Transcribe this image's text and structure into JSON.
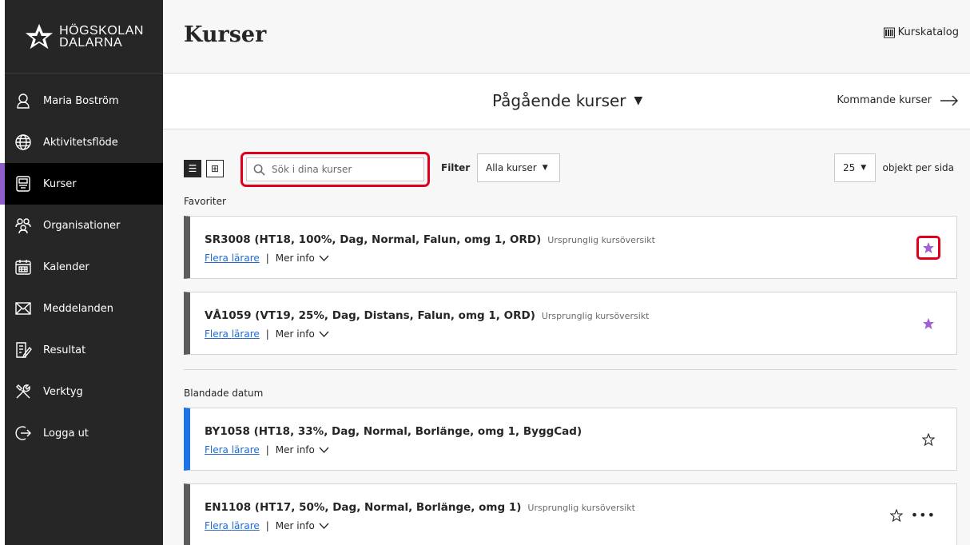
{
  "sidebar": {
    "logo_line1": "HÖGSKOLAN",
    "logo_line2": "DALARNA",
    "items": [
      {
        "label": "Maria Boström",
        "icon": "user-icon"
      },
      {
        "label": "Aktivitetsflöde",
        "icon": "globe-icon"
      },
      {
        "label": "Kurser",
        "icon": "courses-icon"
      },
      {
        "label": "Organisationer",
        "icon": "organizations-icon"
      },
      {
        "label": "Kalender",
        "icon": "calendar-icon"
      },
      {
        "label": "Meddelanden",
        "icon": "envelope-icon"
      },
      {
        "label": "Resultat",
        "icon": "grades-icon"
      },
      {
        "label": "Verktyg",
        "icon": "tools-icon"
      },
      {
        "label": "Logga ut",
        "icon": "logout-icon"
      }
    ],
    "active_item": "Kurser"
  },
  "header": {
    "title": "Kurser",
    "catalog_label": "Kurskatalog"
  },
  "term_bar": {
    "current_term": "Pågående kurser",
    "next_label": "Kommande kurser"
  },
  "toolbar": {
    "search_placeholder": "Sök i dina kurser",
    "filter_label": "Filter",
    "filter_value": "Alla kurser",
    "per_page_value": "25",
    "per_page_label": "objekt per sida"
  },
  "groups": {
    "favorites_label": "Favoriter",
    "mixed_label": "Blandade datum"
  },
  "courses": [
    {
      "title": "SR3008 (HT18, 100%, Dag, Normal, Falun, omg 1, ORD)",
      "subtitle": "Ursprunglig kursöversikt",
      "teachers": "Flera lärare",
      "more": "Mer info",
      "favorite": true
    },
    {
      "title": "VÅ1059 (VT19, 25%, Dag, Distans, Falun, omg 1, ORD)",
      "subtitle": "Ursprunglig kursöversikt",
      "teachers": "Flera lärare",
      "more": "Mer info",
      "favorite": true
    },
    {
      "title": "BY1058 (HT18, 33%, Dag, Normal, Borlänge, omg 1, ByggCad)",
      "subtitle": "",
      "teachers": "Flera lärare",
      "more": "Mer info",
      "favorite": false
    },
    {
      "title": "EN1108 (HT17, 50%, Dag, Normal, Borlänge, omg 1)",
      "subtitle": "Ursprunglig kursöversikt",
      "teachers": "Flera lärare",
      "more": "Mer info",
      "favorite": false
    }
  ],
  "colors": {
    "sidebar_bg": "#262626",
    "active_accent": "#8f5fc9",
    "favorite_star": "#a35fd6",
    "highlight_red": "#e0001b",
    "link_blue": "#1e6bd1",
    "card_bar_blue": "#1e74e6",
    "card_bar_gray": "#5c5c5c"
  }
}
